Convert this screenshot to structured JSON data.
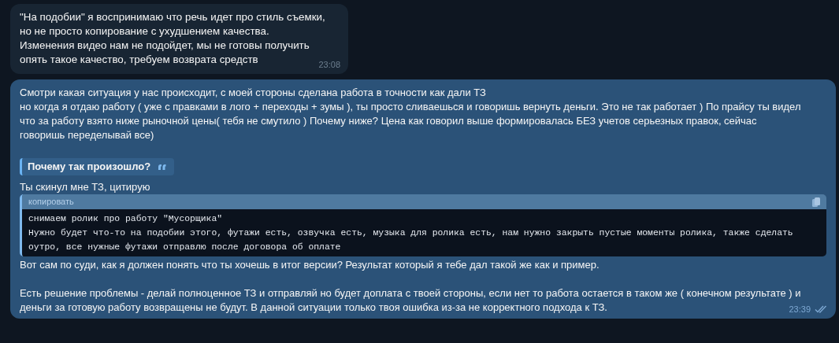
{
  "messages": [
    {
      "kind": "incoming",
      "blocks": [
        {
          "kind": "text",
          "lines": [
            "\"На подобии\" я воспринимаю что речь идет про стиль съемки,",
            "но не просто копирование с ухудшением качества.",
            "Изменения видео нам не подойдет, мы не готовы получить",
            "опять такое качество, требуем возврата средств"
          ]
        }
      ],
      "time": "23:08"
    },
    {
      "kind": "outgoing",
      "blocks": [
        {
          "kind": "text",
          "lines": [
            "Смотри какая ситуация у нас происходит, с моей стороны сделана работа в точности как дали ТЗ",
            "но когда я отдаю работу ( уже с правками в лого + переходы + зумы ), ты просто сливаешься и говоришь вернуть деньги. Это не так работает ) По прайсу ты видел",
            "что за работу взято ниже рыночной цены( тебя не смутило ) Почему ниже? Цена как говорил выше формировалась БЕЗ учетов серьезных правок, сейчас",
            "говоришь переделывай все)"
          ]
        },
        {
          "kind": "gap"
        },
        {
          "kind": "quote",
          "text": "Почему так произошло?"
        },
        {
          "kind": "text",
          "lines": [
            "Ты скинул мне ТЗ, цитирую"
          ]
        },
        {
          "kind": "code",
          "header": "копировать",
          "lines": [
            "снимаем ролик про работу \"Мусорщика\"",
            "Нужно будет что-то на подобии этого, футажи есть, озвучка есть, музыка для ролика есть, нам нужно закрыть пустые моменты ролика, также сделать",
            "оутро, все нужные футажи отправлю после договора об оплате"
          ]
        },
        {
          "kind": "text",
          "lines": [
            "Вот сам по суди, как я должен понять что ты хочешь в итог версии? Результат который я тебе дал такой же как и пример."
          ]
        },
        {
          "kind": "gap"
        },
        {
          "kind": "text",
          "lines": [
            "Есть решение проблемы - делай полноценное ТЗ и отправляй но будет доплата с твоей стороны, если нет то работа остается в таком же ( конечном результате ) и",
            "деньги за готовую работу возвращены не будут. В данной ситуации только твоя ошибка из-за не корректного подхода к ТЗ."
          ]
        }
      ],
      "time": "23:39",
      "read": true
    }
  ]
}
